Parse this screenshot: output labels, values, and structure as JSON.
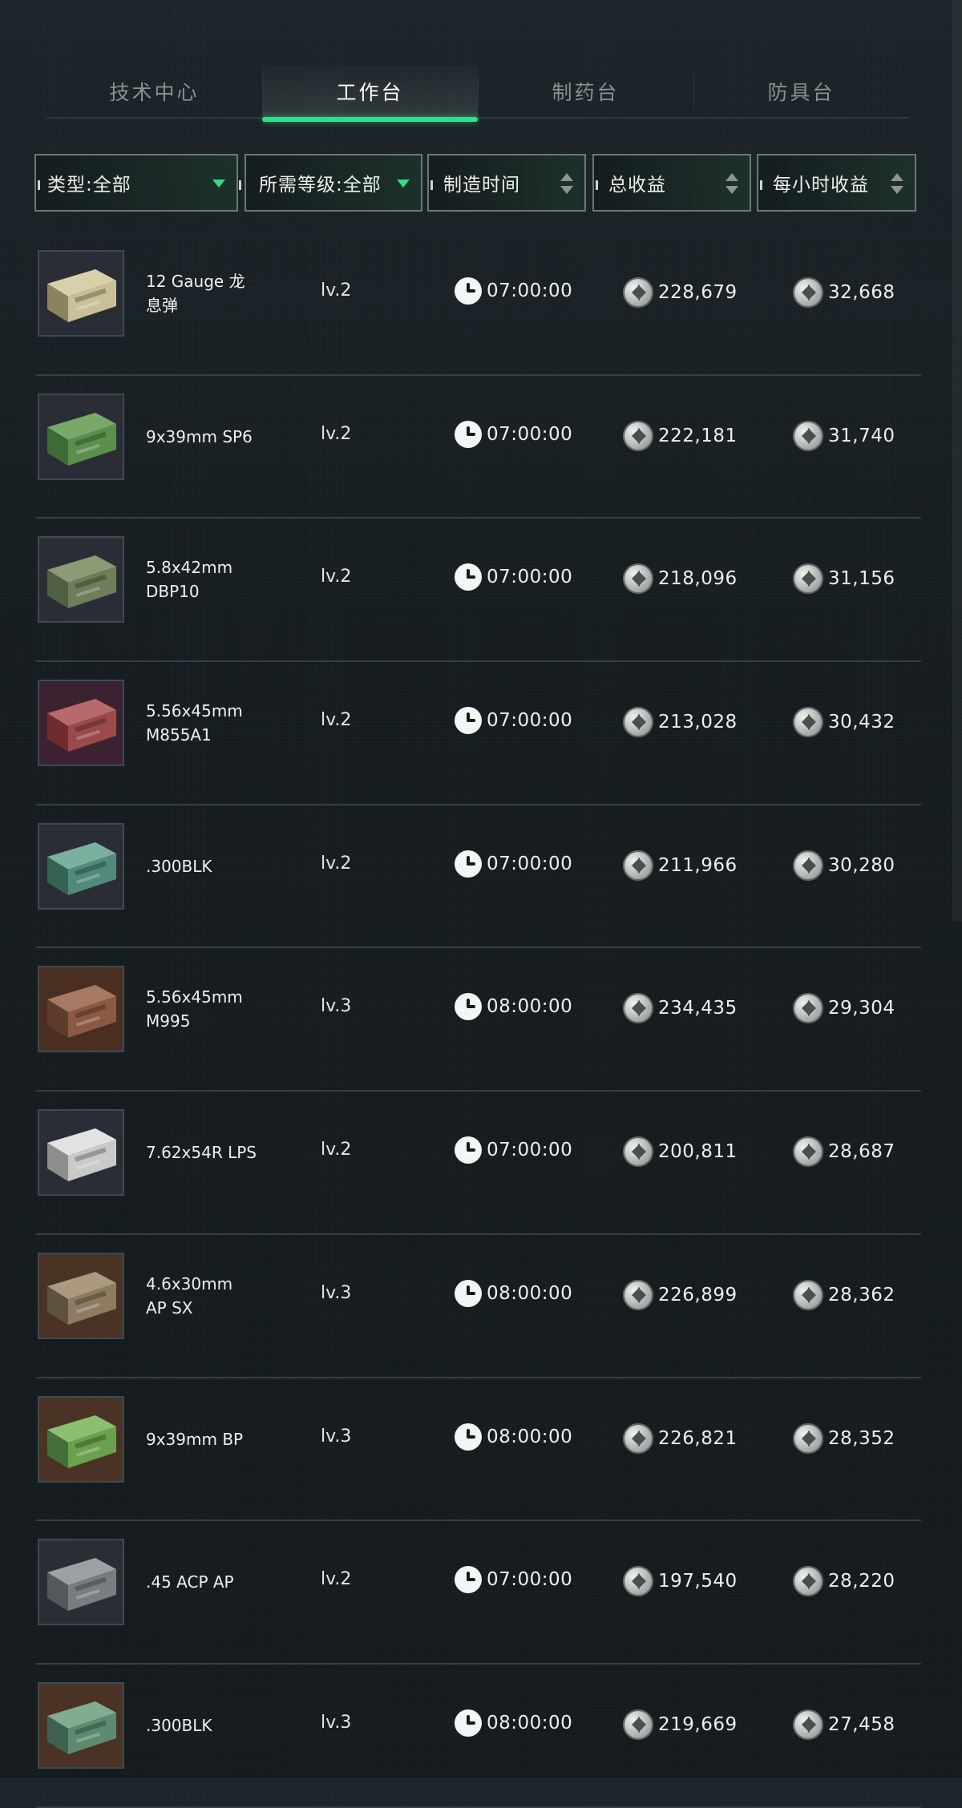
{
  "tabs": [
    {
      "label": "技术中心",
      "active": false
    },
    {
      "label": "工作台",
      "active": true
    },
    {
      "label": "制药台",
      "active": false
    },
    {
      "label": "防具台",
      "active": false
    }
  ],
  "filters": {
    "type": "类型:全部",
    "level": "所需等级:全部",
    "time": "制造时间",
    "total": "总收益",
    "hourly": "每小时收益"
  },
  "colors": {
    "accent": "#2fe08a",
    "background": "#141b1f"
  },
  "icons": {
    "time": "clock-icon",
    "currency": "coin-icon"
  },
  "rows": [
    {
      "name": "12 Gauge 龙息弹",
      "level": "lv.2",
      "time": "07:00:00",
      "total": "228,679",
      "hourly": "32,668"
    },
    {
      "name": "9x39mm SP6",
      "level": "lv.2",
      "time": "07:00:00",
      "total": "222,181",
      "hourly": "31,740"
    },
    {
      "name": "5.8x42mm DBP10",
      "level": "lv.2",
      "time": "07:00:00",
      "total": "218,096",
      "hourly": "31,156"
    },
    {
      "name": "5.56x45mm M855A1",
      "level": "lv.2",
      "time": "07:00:00",
      "total": "213,028",
      "hourly": "30,432"
    },
    {
      "name": ".300BLK",
      "level": "lv.2",
      "time": "07:00:00",
      "total": "211,966",
      "hourly": "30,280"
    },
    {
      "name": "5.56x45mm M995",
      "level": "lv.3",
      "time": "08:00:00",
      "total": "234,435",
      "hourly": "29,304"
    },
    {
      "name": "7.62x54R LPS",
      "level": "lv.2",
      "time": "07:00:00",
      "total": "200,811",
      "hourly": "28,687"
    },
    {
      "name": "4.6x30mm AP SX",
      "level": "lv.3",
      "time": "08:00:00",
      "total": "226,899",
      "hourly": "28,362"
    },
    {
      "name": "9x39mm BP",
      "level": "lv.3",
      "time": "08:00:00",
      "total": "226,821",
      "hourly": "28,352"
    },
    {
      "name": ".45 ACP AP",
      "level": "lv.2",
      "time": "07:00:00",
      "total": "197,540",
      "hourly": "28,220"
    },
    {
      "name": ".300BLK",
      "level": "lv.3",
      "time": "08:00:00",
      "total": "219,669",
      "hourly": "27,458"
    }
  ]
}
